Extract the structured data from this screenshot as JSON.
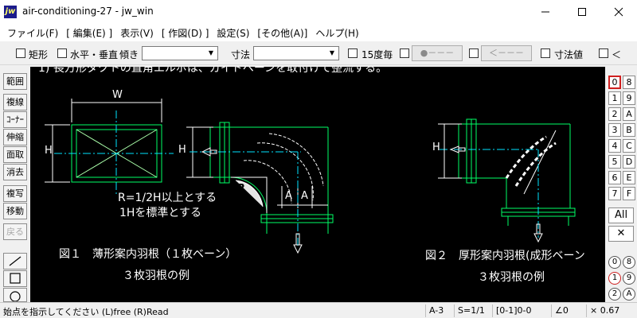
{
  "window": {
    "icon_text": "jw",
    "title": "air-conditioning-27 - jw_win"
  },
  "menu": [
    "ファイル(F)",
    "[ 編集(E) ]",
    "表示(V)",
    "[ 作図(D) ]",
    "設定(S)",
    "[その他(A)]",
    "ヘルプ(H)"
  ],
  "toolbar": {
    "rect_label": "矩形",
    "hv_label": "水平・垂直",
    "tilt_label": "傾き",
    "dim_label": "寸法",
    "deg15_label": "15度毎",
    "btn1_label": "●－－－",
    "btn2_label": "＜－－－",
    "dimval_label": "寸法値",
    "lt_label": "＜"
  },
  "left_tools": [
    "範囲",
    "複線",
    "ｺｰﾅｰ",
    "伸縮",
    "面取",
    "消去",
    "複写",
    "移動",
    "戻る"
  ],
  "canvas": {
    "top_text": "1) 長方形ダクトの直角エルボは、ガイドベーンを取付けて整流する。",
    "label_w": "W",
    "label_h1": "H",
    "label_h2": "H",
    "label_h3": "H",
    "label_r": "R",
    "label_a1": "A",
    "label_a2": "A",
    "note1": "R=1/2H以上とする",
    "note2": "1Hを標準とする",
    "fig1_caption": "図１　薄形案内羽根（１枚ベーン）",
    "fig1_sub": "３枚羽根の例",
    "fig2_caption": "図２　厚形案内羽根(成形ベーン",
    "fig2_sub": "３枚羽根の例"
  },
  "layers": {
    "left": [
      "0",
      "1",
      "2",
      "3",
      "4",
      "5",
      "6",
      "7"
    ],
    "right": [
      "8",
      "9",
      "A",
      "B",
      "C",
      "D",
      "E",
      "F"
    ],
    "all_label": "All",
    "x_label": "✕",
    "group_left": [
      "0",
      "1",
      "2"
    ],
    "group_right": [
      "8",
      "9",
      "A"
    ]
  },
  "status": {
    "message": "始点を指示してください (L)free (R)Read",
    "paper": "A-3",
    "scale": "S=1/1",
    "layer": "[0-1]0-0",
    "angle": "∠0",
    "zoom": "× 0.67"
  },
  "colors": {
    "green": "#00ff66",
    "white": "#ffffff",
    "cyan": "#00e5ff",
    "canvas_bg": "#000000",
    "active_layer": "#d02020"
  }
}
